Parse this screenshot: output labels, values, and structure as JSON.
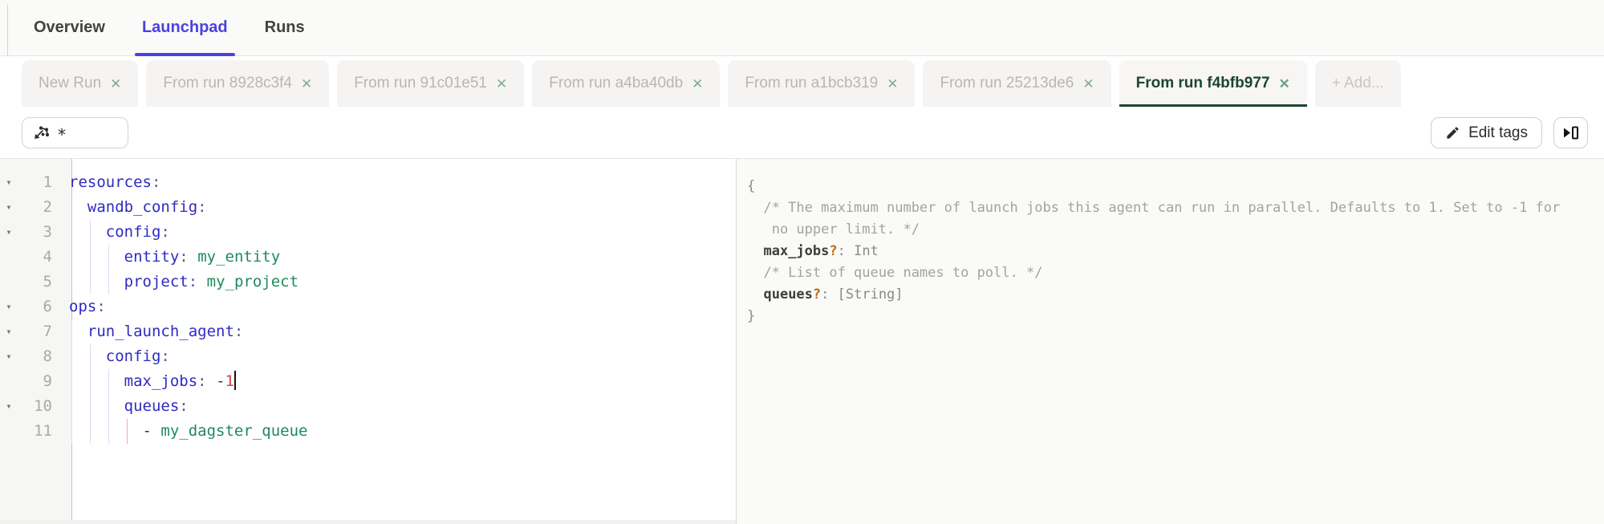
{
  "topnav": {
    "tabs": [
      {
        "label": "Overview",
        "active": false
      },
      {
        "label": "Launchpad",
        "active": true
      },
      {
        "label": "Runs",
        "active": false
      }
    ],
    "active_color": "#4B42DD"
  },
  "run_tabs": {
    "tabs": [
      {
        "label": "New Run",
        "closable": true,
        "active": false
      },
      {
        "label": "From run 8928c3f4",
        "closable": true,
        "active": false
      },
      {
        "label": "From run 91c01e51",
        "closable": true,
        "active": false
      },
      {
        "label": "From run a4ba40db",
        "closable": true,
        "active": false
      },
      {
        "label": "From run a1bcb319",
        "closable": true,
        "active": false
      },
      {
        "label": "From run 25213de6",
        "closable": true,
        "active": false
      },
      {
        "label": "From run f4bfb977",
        "closable": true,
        "active": true
      }
    ],
    "add_label": "+ Add...",
    "active_color": "#1C4532"
  },
  "toolbar": {
    "op_selector_value": "*",
    "edit_tags_label": "Edit tags"
  },
  "icons": {
    "close": "✕",
    "fold": "▾"
  },
  "editor": {
    "language": "yaml",
    "lines": [
      {
        "n": 1,
        "fold": true,
        "guides": [],
        "tokens": [
          {
            "t": "key",
            "v": "resources"
          },
          {
            "t": "pun",
            "v": ":"
          }
        ]
      },
      {
        "n": 2,
        "fold": true,
        "guides": [
          {
            "c": 0,
            "k": "teal"
          }
        ],
        "tokens": [
          {
            "t": "ws",
            "v": "  "
          },
          {
            "t": "key",
            "v": "wandb_config"
          },
          {
            "t": "pun",
            "v": ":"
          }
        ]
      },
      {
        "n": 3,
        "fold": true,
        "guides": [
          {
            "c": 0,
            "k": "teal"
          },
          {
            "c": 2,
            "k": "lav"
          }
        ],
        "tokens": [
          {
            "t": "ws",
            "v": "    "
          },
          {
            "t": "key",
            "v": "config"
          },
          {
            "t": "pun",
            "v": ":"
          }
        ]
      },
      {
        "n": 4,
        "fold": false,
        "guides": [
          {
            "c": 0,
            "k": "teal"
          },
          {
            "c": 2,
            "k": "lav"
          },
          {
            "c": 4,
            "k": "lav"
          }
        ],
        "tokens": [
          {
            "t": "ws",
            "v": "      "
          },
          {
            "t": "key",
            "v": "entity"
          },
          {
            "t": "pun",
            "v": ":"
          },
          {
            "t": "ws",
            "v": " "
          },
          {
            "t": "val",
            "v": "my_entity"
          }
        ]
      },
      {
        "n": 5,
        "fold": false,
        "guides": [
          {
            "c": 0,
            "k": "teal"
          },
          {
            "c": 2,
            "k": "lav"
          },
          {
            "c": 4,
            "k": "lav"
          }
        ],
        "tokens": [
          {
            "t": "ws",
            "v": "      "
          },
          {
            "t": "key",
            "v": "project"
          },
          {
            "t": "pun",
            "v": ":"
          },
          {
            "t": "ws",
            "v": " "
          },
          {
            "t": "val",
            "v": "my_project"
          }
        ]
      },
      {
        "n": 6,
        "fold": true,
        "guides": [],
        "tokens": [
          {
            "t": "key",
            "v": "ops"
          },
          {
            "t": "pun",
            "v": ":"
          }
        ]
      },
      {
        "n": 7,
        "fold": true,
        "guides": [
          {
            "c": 0,
            "k": "lav"
          }
        ],
        "tokens": [
          {
            "t": "ws",
            "v": "  "
          },
          {
            "t": "key",
            "v": "run_launch_agent"
          },
          {
            "t": "pun",
            "v": ":"
          }
        ]
      },
      {
        "n": 8,
        "fold": true,
        "guides": [
          {
            "c": 0,
            "k": "lav"
          },
          {
            "c": 2,
            "k": "lav"
          }
        ],
        "tokens": [
          {
            "t": "ws",
            "v": "    "
          },
          {
            "t": "key",
            "v": "config"
          },
          {
            "t": "pun",
            "v": ":"
          }
        ]
      },
      {
        "n": 9,
        "fold": false,
        "guides": [
          {
            "c": 0,
            "k": "lav"
          },
          {
            "c": 2,
            "k": "lav"
          },
          {
            "c": 4,
            "k": "lav"
          }
        ],
        "tokens": [
          {
            "t": "ws",
            "v": "      "
          },
          {
            "t": "key",
            "v": "max_jobs"
          },
          {
            "t": "pun",
            "v": ":"
          },
          {
            "t": "ws",
            "v": " "
          },
          {
            "t": "txt",
            "v": "-"
          },
          {
            "t": "num",
            "v": "1"
          },
          {
            "t": "cursor",
            "v": ""
          }
        ]
      },
      {
        "n": 10,
        "fold": true,
        "guides": [
          {
            "c": 0,
            "k": "lav"
          },
          {
            "c": 2,
            "k": "lav"
          },
          {
            "c": 4,
            "k": "lav"
          }
        ],
        "tokens": [
          {
            "t": "ws",
            "v": "      "
          },
          {
            "t": "key",
            "v": "queues"
          },
          {
            "t": "pun",
            "v": ":"
          }
        ]
      },
      {
        "n": 11,
        "fold": false,
        "guides": [
          {
            "c": 0,
            "k": "lav"
          },
          {
            "c": 2,
            "k": "lav"
          },
          {
            "c": 4,
            "k": "lav"
          },
          {
            "c": 6,
            "k": "red"
          }
        ],
        "tokens": [
          {
            "t": "ws",
            "v": "        "
          },
          {
            "t": "txt",
            "v": "-"
          },
          {
            "t": "ws",
            "v": " "
          },
          {
            "t": "val",
            "v": "my_dagster_queue"
          }
        ]
      }
    ]
  },
  "schema": {
    "lines": [
      [
        {
          "t": "p",
          "v": "{"
        }
      ],
      [
        {
          "t": "c",
          "v": "  /* The maximum number of launch jobs this agent can run in parallel. Defaults to 1. Set to -1 for"
        }
      ],
      [
        {
          "t": "c",
          "v": "   no upper limit. */"
        }
      ],
      [
        {
          "t": "c",
          "v": "  "
        },
        {
          "t": "prop",
          "v": "max_jobs"
        },
        {
          "t": "q",
          "v": "?"
        },
        {
          "t": "p",
          "v": ": "
        },
        {
          "t": "type",
          "v": "Int"
        }
      ],
      [
        {
          "t": "c",
          "v": "  /* List of queue names to poll. */"
        }
      ],
      [
        {
          "t": "c",
          "v": "  "
        },
        {
          "t": "prop",
          "v": "queues"
        },
        {
          "t": "q",
          "v": "?"
        },
        {
          "t": "p",
          "v": ": "
        },
        {
          "t": "type",
          "v": "[String]"
        }
      ],
      [
        {
          "t": "p",
          "v": "}"
        }
      ]
    ]
  },
  "colors": {
    "accent_purple": "#4B42DD",
    "active_tab_green": "#1C4532",
    "yaml_key_blue": "#2F2BC0",
    "yaml_value_green": "#1E8A5C",
    "yaml_number_red": "#D8423C",
    "schema_optional_orange": "#C2690F"
  }
}
